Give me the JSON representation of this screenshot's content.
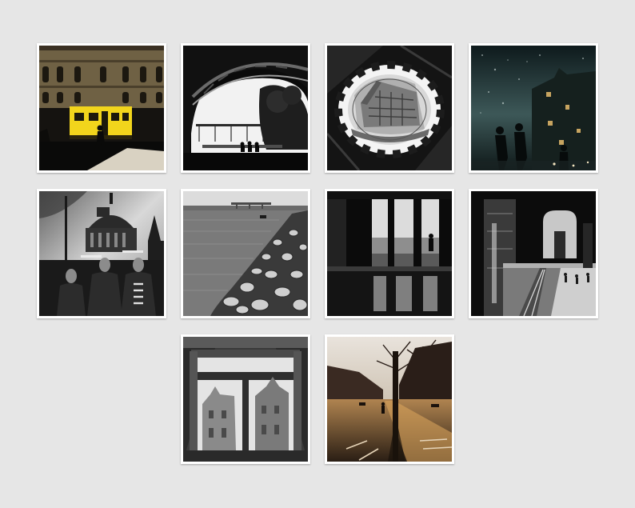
{
  "gallery": {
    "background_color": "#e6e6e6",
    "frame_color": "#ffffff",
    "photos": [
      {
        "subject": "yellow-tram"
      },
      {
        "subject": "bridge-arch"
      },
      {
        "subject": "convex-mirror"
      },
      {
        "subject": "rainy-reflection"
      },
      {
        "subject": "basilica-mannequins"
      },
      {
        "subject": "riverbank-rocks"
      },
      {
        "subject": "glass-doors"
      },
      {
        "subject": "arched-window-street"
      },
      {
        "subject": "window-church"
      },
      {
        "subject": "avenue-sunset"
      }
    ]
  }
}
